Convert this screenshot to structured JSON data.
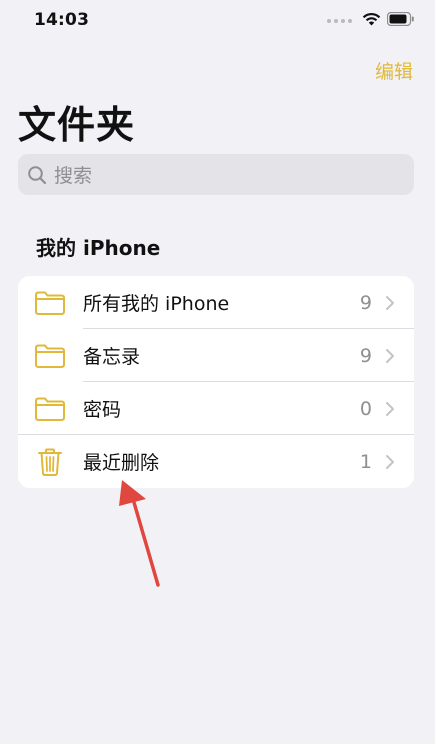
{
  "status_bar": {
    "time": "14:03"
  },
  "nav": {
    "edit_label": "编辑"
  },
  "title": "文件夹",
  "search": {
    "placeholder": "搜索"
  },
  "section": {
    "header": "我的 iPhone"
  },
  "folders": [
    {
      "label": "所有我的 iPhone",
      "count": "9",
      "icon": "folder-icon"
    },
    {
      "label": "备忘录",
      "count": "9",
      "icon": "folder-icon"
    },
    {
      "label": "密码",
      "count": "0",
      "icon": "folder-icon"
    },
    {
      "label": "最近删除",
      "count": "1",
      "icon": "trash-icon"
    }
  ],
  "colors": {
    "accent": "#e0b93b",
    "background": "#f2f2f6",
    "annotation_arrow": "#e0473f"
  }
}
